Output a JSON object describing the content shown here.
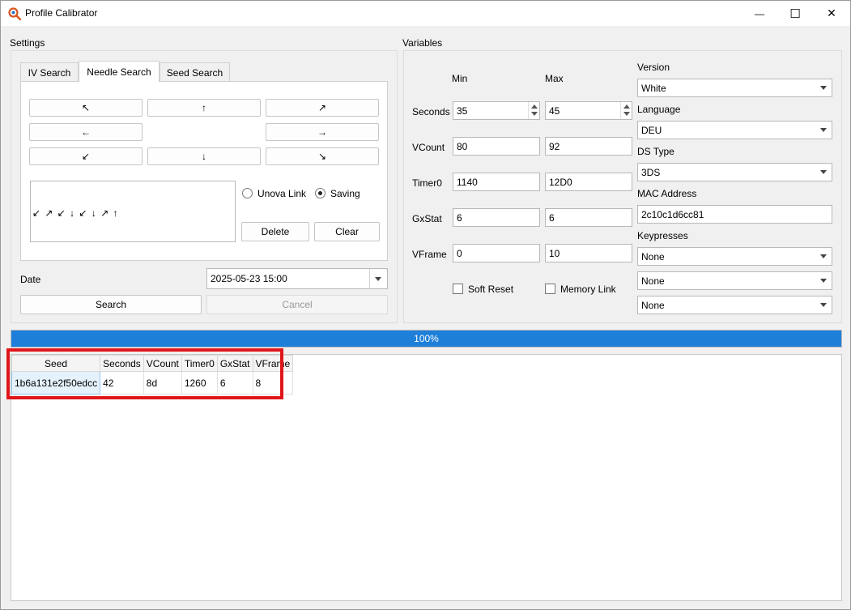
{
  "window": {
    "title": "Profile Calibrator",
    "minimize_glyph": "—",
    "maximize_glyph": "☐",
    "close_glyph": "✕"
  },
  "settings": {
    "group_label": "Settings",
    "tabs": [
      "IV Search",
      "Needle Search",
      "Seed Search"
    ],
    "active_tab": 1,
    "arrows": {
      "up_left": "↖",
      "up": "↑",
      "up_right": "↗",
      "left": "←",
      "right": "→",
      "down_left": "↙",
      "down": "↓",
      "down_right": "↘"
    },
    "sequence_text": "↙ ↗ ↙ ↓ ↙ ↓ ↗ ↑",
    "radio_unova_link": "Unova Link",
    "radio_saving": "Saving",
    "selected_radio": "Saving",
    "delete_label": "Delete",
    "clear_label": "Clear",
    "date_label": "Date",
    "date_value": "2025-05-23 15:00",
    "search_label": "Search",
    "cancel_label": "Cancel"
  },
  "variables": {
    "group_label": "Variables",
    "min_header": "Min",
    "max_header": "Max",
    "rows": [
      {
        "label": "Seconds",
        "min": "35",
        "max": "45"
      },
      {
        "label": "VCount",
        "min": "80",
        "max": "92"
      },
      {
        "label": "Timer0",
        "min": "1140",
        "max": "12D0"
      },
      {
        "label": "GxStat",
        "min": "6",
        "max": "6"
      },
      {
        "label": "VFrame",
        "min": "0",
        "max": "10"
      }
    ],
    "soft_reset_label": "Soft Reset",
    "memory_link_label": "Memory Link",
    "version_label": "Version",
    "version_value": "White",
    "language_label": "Language",
    "language_value": "DEU",
    "ds_type_label": "DS Type",
    "ds_type_value": "3DS",
    "mac_label": "MAC Address",
    "mac_value": "2c10c1d6cc81",
    "keypresses_label": "Keypresses",
    "keypresses_values": [
      "None",
      "None",
      "None"
    ]
  },
  "progress": {
    "text": "100%",
    "value": 1.0
  },
  "results": {
    "columns": [
      "Seed",
      "Seconds",
      "VCount",
      "Timer0",
      "GxStat",
      "VFrame"
    ],
    "rows": [
      [
        "1b6a131e2f50edcc",
        "42",
        "8d",
        "1260",
        "6",
        "8"
      ]
    ]
  },
  "colors": {
    "progress_fill": "#1e7fd8",
    "highlight": "#e0161a",
    "app_icon": "#d9541e"
  }
}
